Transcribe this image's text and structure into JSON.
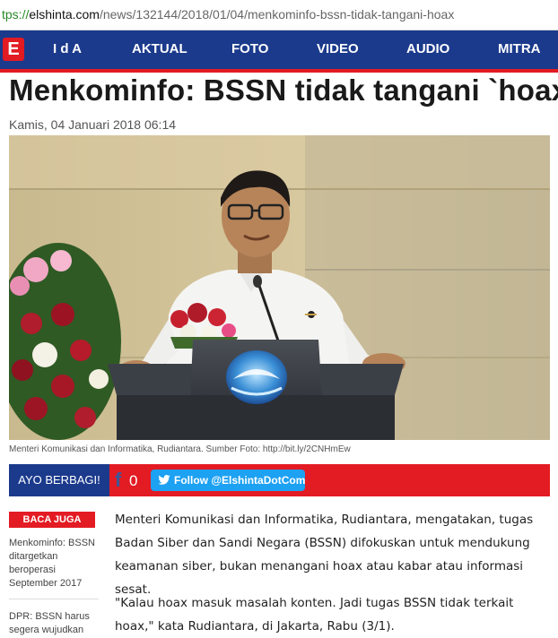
{
  "browser": {
    "url_scheme": "tps://",
    "url_host": "elshinta.com",
    "url_path": "/news/132144/2018/01/04/menkominfo-bssn-tidak-tangani-hoax"
  },
  "nav": {
    "logo": "E",
    "items": [
      "I d A",
      "AKTUAL",
      "FOTO",
      "VIDEO",
      "AUDIO",
      "MITRA"
    ]
  },
  "article": {
    "title": "Menkominfo: BSSN tidak tangani `hoax`",
    "date": "Kamis, 04 Januari 2018 06:14",
    "photo_caption": "Menteri Komunikasi dan Informatika, Rudiantara. Sumber Foto: http://bit.ly/2CNHmEw",
    "paragraphs": [
      "Menteri Komunikasi dan Informatika, Rudiantara, mengatakan, tugas Badan Siber dan Sandi Negara (BSSN) difokuskan untuk mendukung keamanan siber, bukan menangani hoax atau kabar atau informasi sesat.",
      "\"Kalau hoax masuk masalah konten. Jadi tugas BSSN tidak terkait hoax,\" kata Rudiantara, di Jakarta, Rabu (3/1)."
    ]
  },
  "share": {
    "label": "AYO BERBAGI!",
    "fb_icon": "f",
    "fb_count": "0",
    "twitter_label": "Follow @ElshintaDotCom"
  },
  "related": {
    "header": "BACA JUGA",
    "items": [
      "Menkominfo: BSSN ditargetkan beroperasi September 2017",
      "DPR: BSSN harus segera wujudkan"
    ]
  },
  "colors": {
    "nav_blue": "#1b3a8c",
    "accent_red": "#e31b23",
    "twitter_blue": "#1da1f2"
  }
}
